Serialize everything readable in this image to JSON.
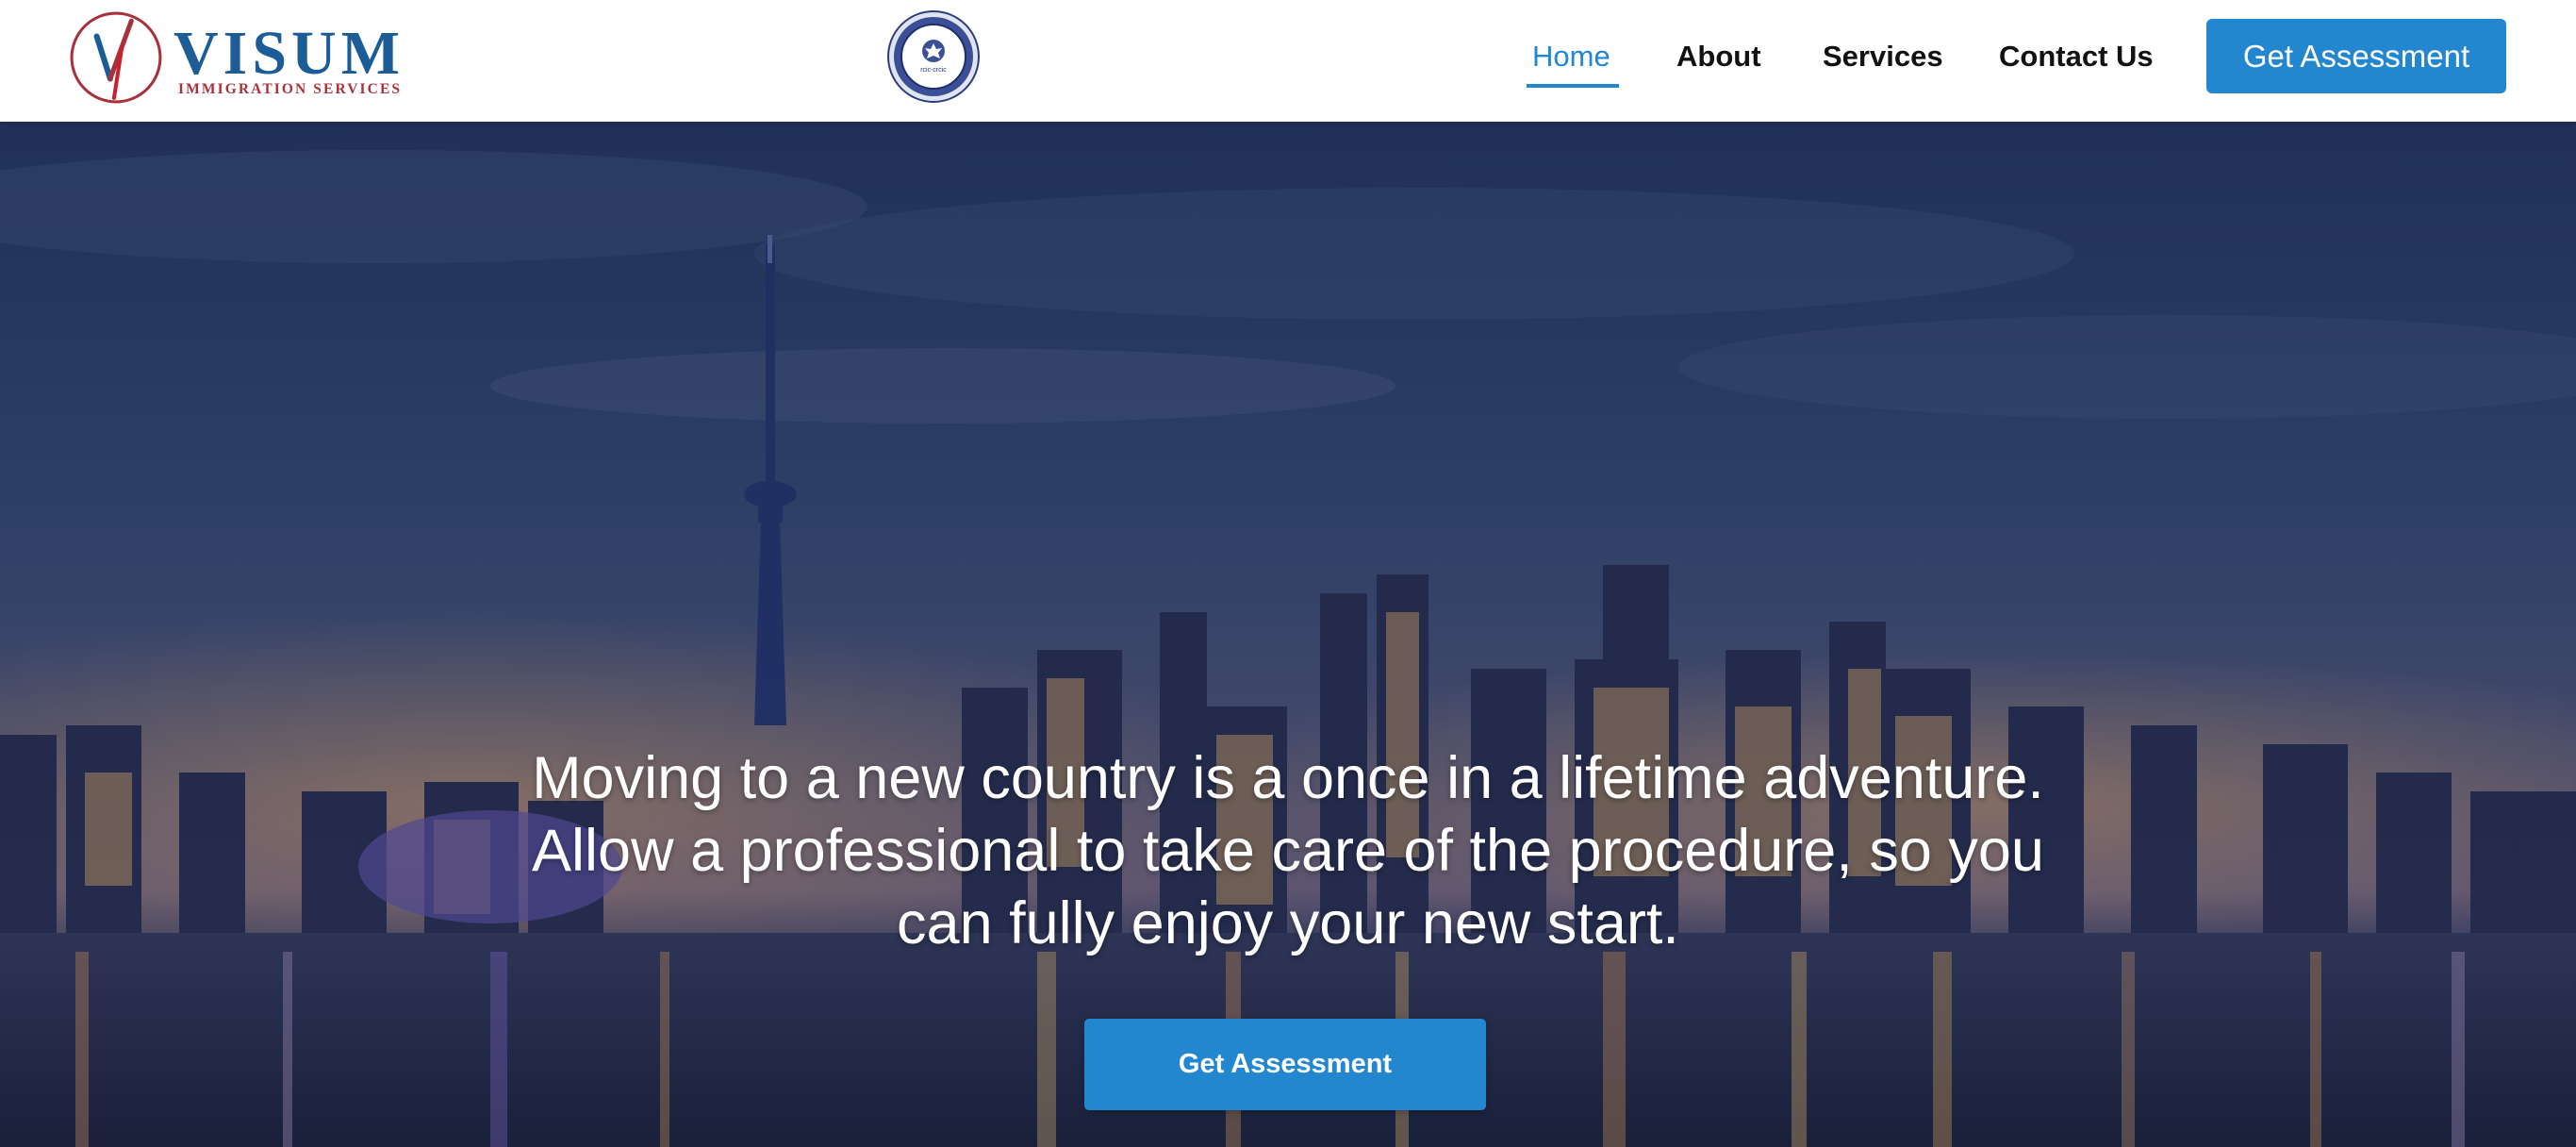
{
  "brand": {
    "name": "VISUM",
    "tagline": "IMMIGRATION SERVICES",
    "seal_text": "rcic-crcic"
  },
  "nav": {
    "items": [
      {
        "label": "Home",
        "active": true
      },
      {
        "label": "About",
        "active": false
      },
      {
        "label": "Services",
        "active": false
      },
      {
        "label": "Contact Us",
        "active": false
      }
    ],
    "cta_label": "Get Assessment"
  },
  "hero": {
    "headline": "Moving to a new country is a once in a lifetime adventure. Allow a professional to take care of the procedure, so you can fully enjoy your new start.",
    "cta_label": "Get Assessment",
    "background": "toronto-skyline-night"
  },
  "colors": {
    "accent": "#2387d0",
    "brand_blue": "#1c5d98",
    "brand_red": "#a8323c"
  }
}
